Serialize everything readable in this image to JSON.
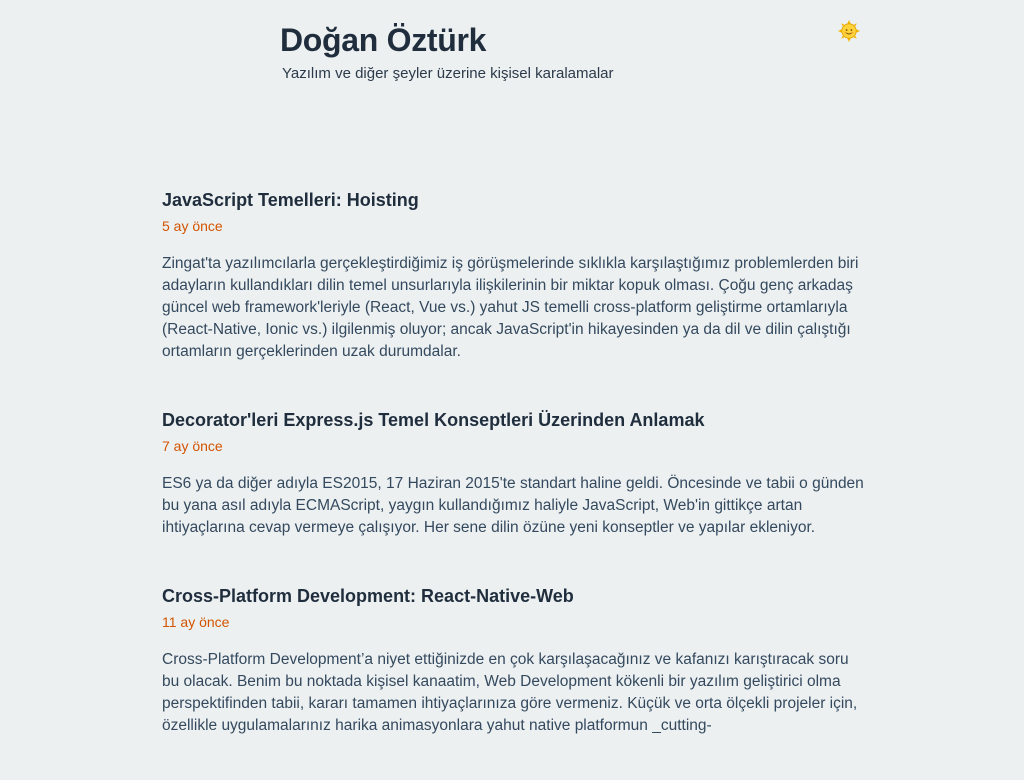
{
  "site": {
    "title": "Doğan Öztürk",
    "tagline": "Yazılım ve diğer şeyler üzerine kişisel karalamalar",
    "theme_icon": "sun-face-icon"
  },
  "colors": {
    "background": "#ecf0f1",
    "date_accent": "#d35400",
    "title_text": "#1f2d3d",
    "body_text": "#34495e"
  },
  "posts": [
    {
      "title": "JavaScript Temelleri: Hoisting",
      "date": "5 ay önce",
      "excerpt": "Zingat'ta yazılımcılarla gerçekleştirdiğimiz iş görüşmelerinde sıklıkla karşılaştığımız problemlerden biri adayların kullandıkları dilin temel unsurlarıyla ilişkilerinin bir miktar kopuk olması. Çoğu genç arkadaş güncel web framework'leriyle (React, Vue vs.) yahut JS temelli cross-platform geliştirme ortamlarıyla (React-Native, Ionic vs.) ilgilenmiş oluyor; ancak JavaScript'in hikayesinden ya da dil ve dilin çalıştığı ortamların gerçeklerinden uzak durumdalar."
    },
    {
      "title": "Decorator'leri Express.js Temel Konseptleri Üzerinden Anlamak",
      "date": "7 ay önce",
      "excerpt": "ES6 ya da diğer adıyla ES2015, 17 Haziran 2015'te standart haline geldi. Öncesinde ve tabii o günden bu yana asıl adıyla ECMAScript, yaygın kullandığımız haliyle JavaScript, Web'in gittikçe artan ihtiyaçlarına cevap vermeye çalışıyor. Her sene dilin özüne yeni konseptler ve yapılar ekleniyor."
    },
    {
      "title": "Cross-Platform Development: React-Native-Web",
      "date": "11 ay önce",
      "excerpt": "Cross-Platform Development’a niyet ettiğinizde en çok karşılaşacağınız ve kafanızı karıştıracak soru bu olacak. Benim bu noktada kişisel kanaatim, Web Development kökenli bir yazılım geliştirici olma perspektifinden tabii, kararı tamamen ihtiyaçlarınıza göre vermeniz. Küçük ve orta ölçekli projeler için, özellikle uygulamalarınız harika animasyonlara yahut native platformun _cutting-"
    }
  ]
}
